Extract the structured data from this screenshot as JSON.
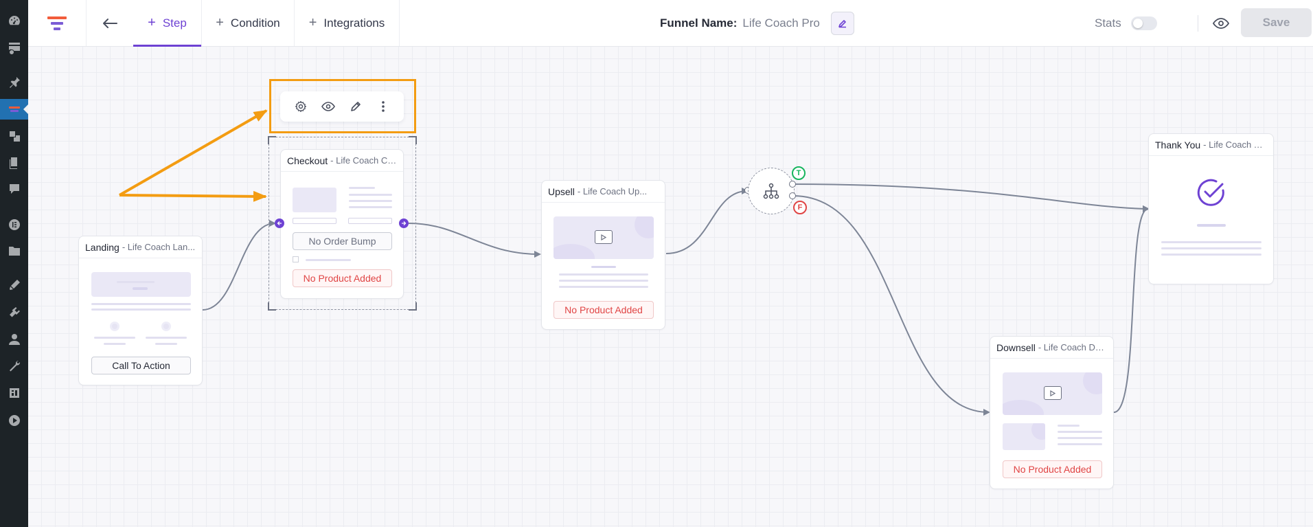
{
  "sidebar": {
    "icons": [
      "dashboard-icon",
      "media-settings-icon",
      "pin-icon",
      "funnel-menu-icon",
      "products-icon",
      "pages-icon",
      "comments-icon",
      "elementor-icon",
      "folder-icon",
      "design-icon",
      "plugins-icon",
      "users-icon",
      "tools-icon",
      "settings-icon",
      "play-icon"
    ],
    "active_index": 3
  },
  "header": {
    "tabs": [
      {
        "label": "Step",
        "active": true
      },
      {
        "label": "Condition",
        "active": false
      },
      {
        "label": "Integrations",
        "active": false
      }
    ],
    "funnel_name_label": "Funnel Name:",
    "funnel_name_value": "Life Coach Pro",
    "stats_label": "Stats",
    "stats_enabled": false,
    "save_label": "Save",
    "accent_color": "#6e42d3"
  },
  "canvas": {
    "landing": {
      "title": "Landing",
      "subtitle": "- Life Coach Lan...",
      "button": "Call To Action"
    },
    "checkout": {
      "title": "Checkout",
      "subtitle": "- Life Coach Ch...",
      "order_bump": "No Order Bump",
      "product": "No Product Added"
    },
    "upsell": {
      "title": "Upsell",
      "subtitle": "- Life Coach Up...",
      "product": "No Product Added"
    },
    "condition": {
      "true_label": "T",
      "false_label": "F"
    },
    "downsell": {
      "title": "Downsell",
      "subtitle": "- Life Coach Do...",
      "product": "No Product Added"
    },
    "thankyou": {
      "title": "Thank You",
      "subtitle": "- Life Coach Tha..."
    },
    "toolbar_icons": [
      "gear-icon",
      "eye-icon",
      "pencil-icon",
      "more-vertical-icon"
    ],
    "annotation_color": "#f39c12"
  }
}
